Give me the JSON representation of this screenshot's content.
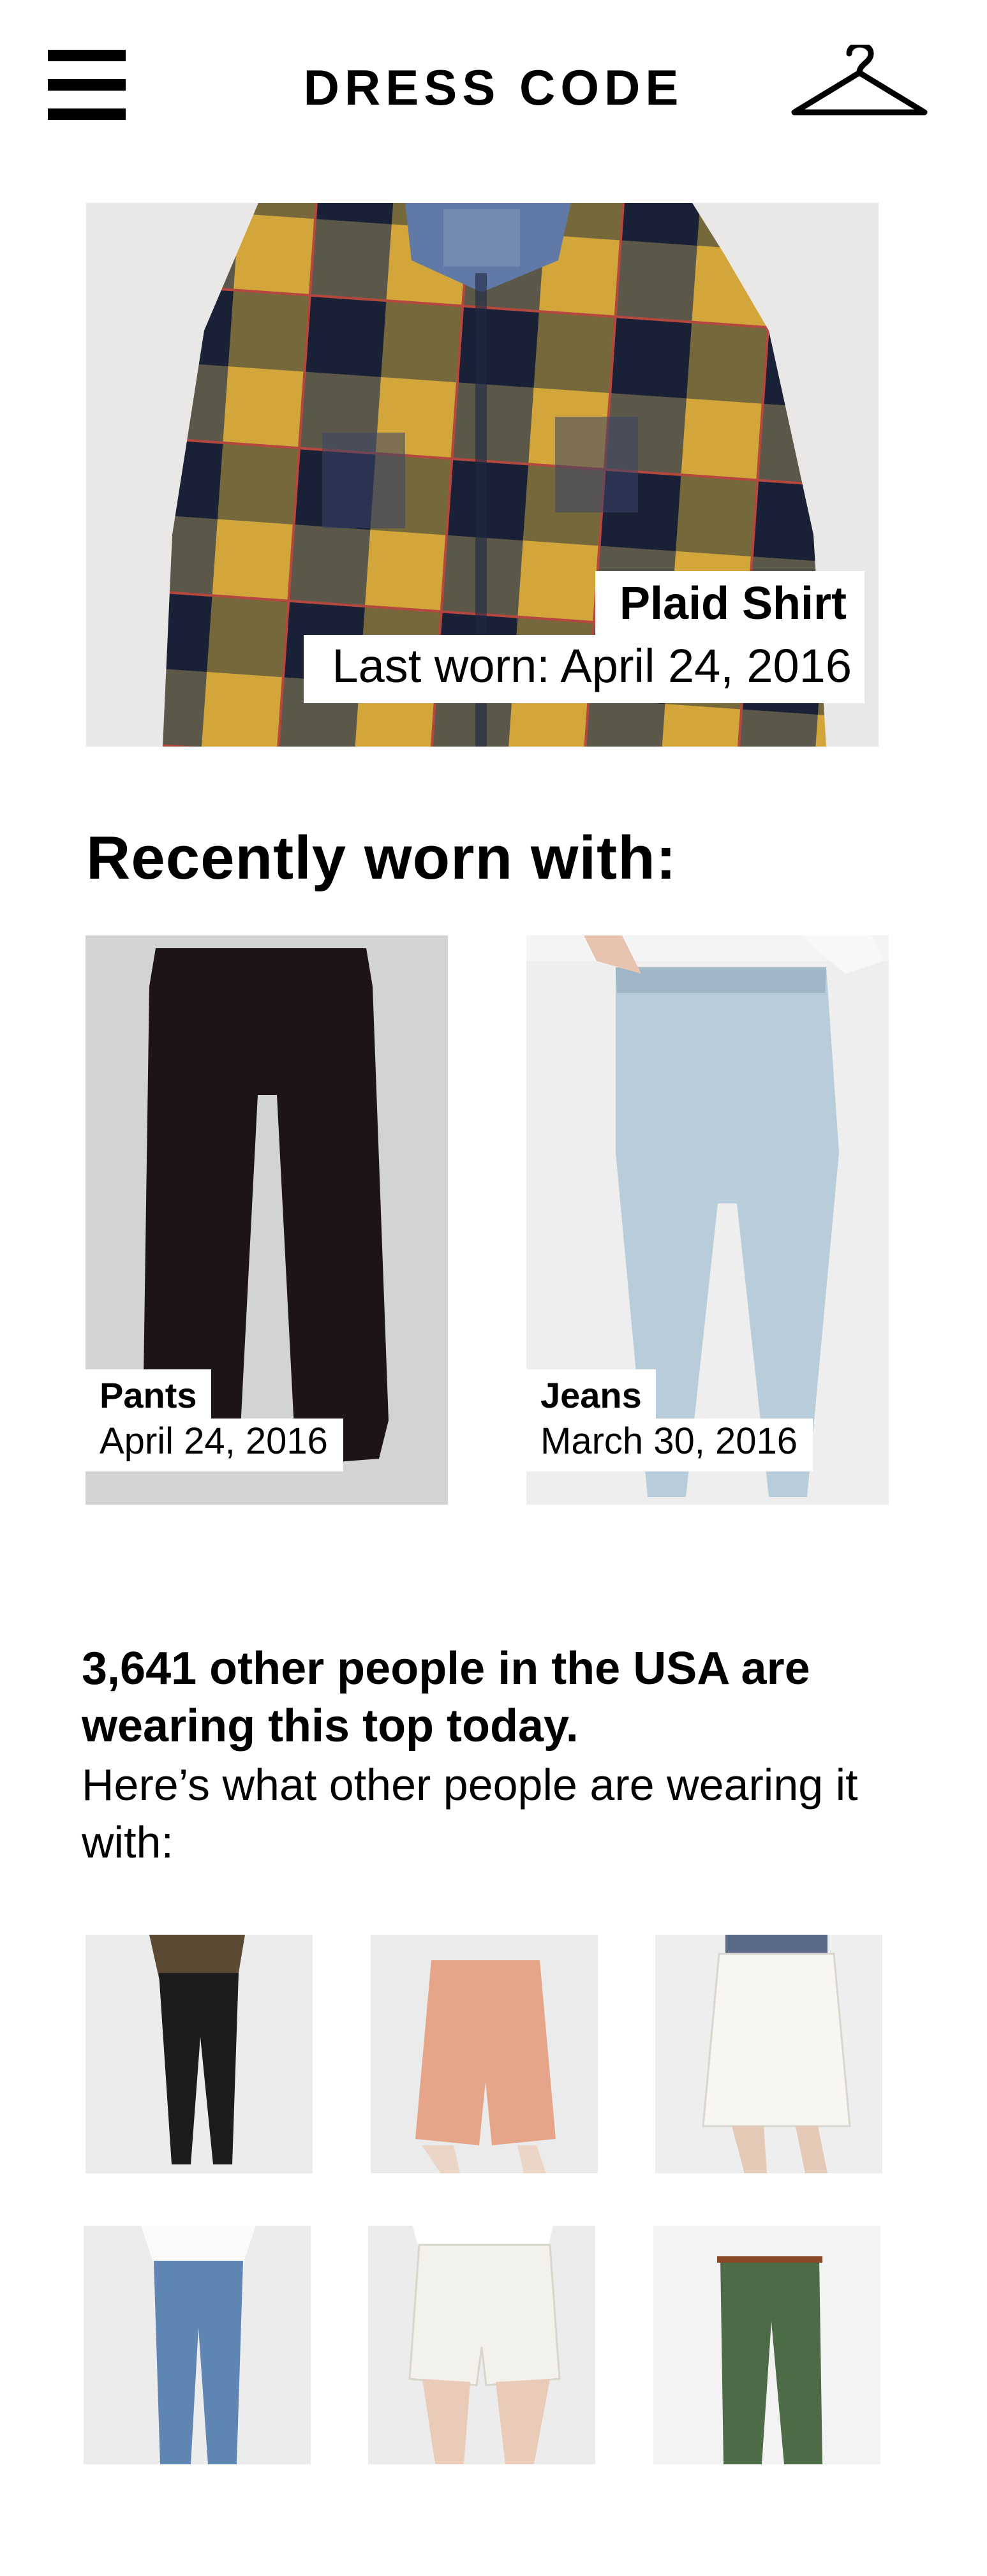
{
  "header": {
    "title": "DRESS CODE",
    "menu_icon": "hamburger-menu-icon",
    "closet_icon": "hanger-icon"
  },
  "featured": {
    "name": "Plaid Shirt",
    "last_worn": "Last worn: April 24, 2016"
  },
  "recent": {
    "title": "Recently worn with:",
    "items": [
      {
        "name": "Pants",
        "date": "April 24, 2016"
      },
      {
        "name": "Jeans",
        "date": "March 30, 2016"
      }
    ]
  },
  "community": {
    "headline": "3,641 other people in the USA are wearing this top today.",
    "subline": "Here’s what other people are wearing it with:",
    "items": [
      "black-skinny-jeans",
      "peach-shorts",
      "white-skirt",
      "blue-jeans",
      "white-shorts",
      "green-trousers"
    ]
  }
}
